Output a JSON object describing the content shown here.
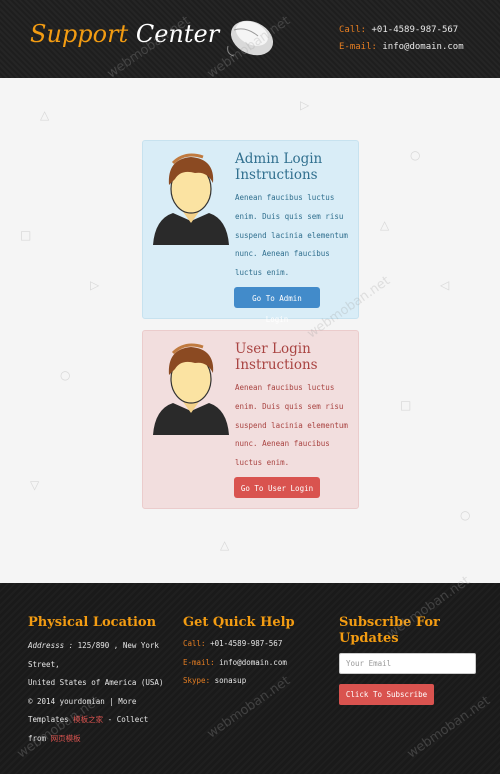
{
  "header": {
    "logo_part1": "Support",
    "logo_part2": "Center",
    "call_label": "Call:",
    "call_value": "+01-4589-987-567",
    "email_label": "E-mail:",
    "email_value": "info@domain.com"
  },
  "admin_panel": {
    "title": "Admin Login Instructions",
    "text": "Aenean faucibus luctus enim. Duis quis sem risu suspend lacinia elementum nunc. Aenean faucibus luctus enim.",
    "button": "Go To Admin Login"
  },
  "user_panel": {
    "title": "User Login Instructions",
    "text": "Aenean faucibus luctus enim. Duis quis sem risu suspend lacinia elementum nunc. Aenean faucibus luctus enim.",
    "button": "Go To User Login"
  },
  "footer": {
    "location": {
      "heading": "Physical Location",
      "address_label": "Addresss :",
      "address_line1": "125/890 , New York Street,",
      "address_line2": "United States of America (USA)",
      "copyright_prefix": "© 2014 yourdomian | More Templates",
      "link1": "模板之家",
      "mid": "- Collect from",
      "link2": "网页模板"
    },
    "help": {
      "heading": "Get Quick Help",
      "call_label": "Call:",
      "call_value": "+01-4589-987-567",
      "email_label": "E-mail:",
      "email_value": "info@domain.com",
      "skype_label": "Skype:",
      "skype_value": "sonasup"
    },
    "subscribe": {
      "heading": "Subscribe For Updates",
      "placeholder": "Your Email",
      "button": "Click To Subscribe"
    }
  },
  "watermark": "webmoban.net",
  "colors": {
    "accent_orange": "#f39c12",
    "info_blue": "#31708f",
    "danger_red": "#d9534f"
  }
}
